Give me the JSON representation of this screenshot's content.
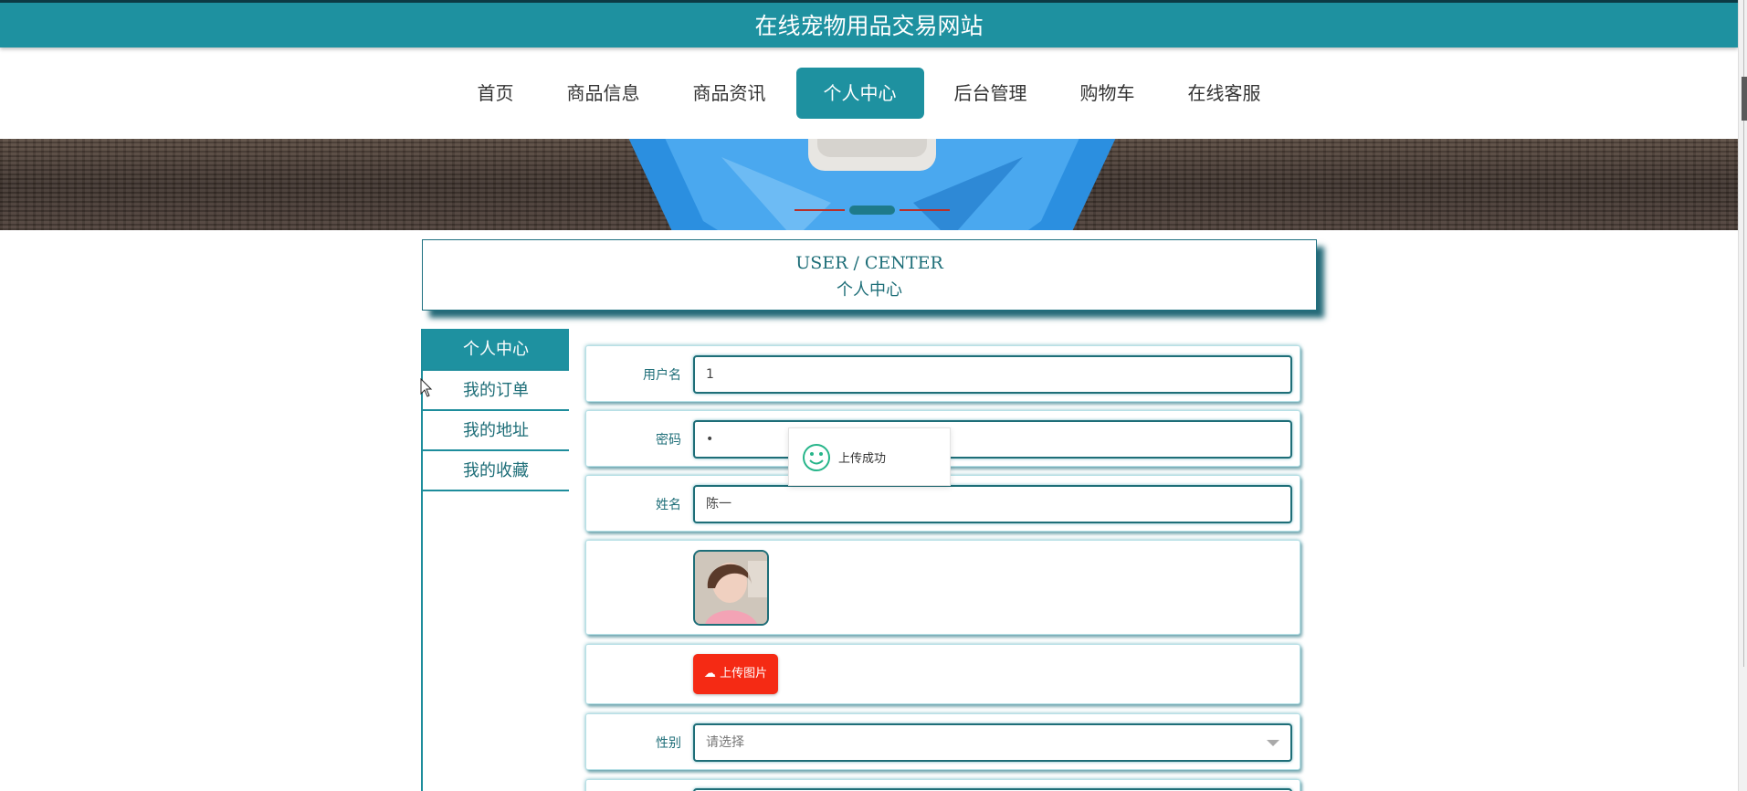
{
  "site": {
    "title": "在线宠物用品交易网站"
  },
  "nav": {
    "items": [
      {
        "label": "首页",
        "active": false
      },
      {
        "label": "商品信息",
        "active": false
      },
      {
        "label": "商品资讯",
        "active": false
      },
      {
        "label": "个人中心",
        "active": true
      },
      {
        "label": "后台管理",
        "active": false
      },
      {
        "label": "购物车",
        "active": false
      },
      {
        "label": "在线客服",
        "active": false
      }
    ]
  },
  "section": {
    "title_en": "USER / CENTER",
    "title_cn": "个人中心"
  },
  "sidebar": {
    "items": [
      {
        "label": "个人中心",
        "active": true
      },
      {
        "label": "我的订单",
        "active": false
      },
      {
        "label": "我的地址",
        "active": false
      },
      {
        "label": "我的收藏",
        "active": false
      }
    ]
  },
  "form": {
    "username": {
      "label": "用户名",
      "value": "1"
    },
    "password": {
      "label": "密码",
      "value": "•"
    },
    "name": {
      "label": "姓名",
      "value": "陈一"
    },
    "avatar": {
      "icon": "avatar-photo"
    },
    "upload": {
      "label": "上传图片",
      "icon": "cloud-upload-icon"
    },
    "gender": {
      "label": "性别",
      "placeholder": "请选择"
    }
  },
  "toast": {
    "message": "上传成功",
    "icon": "smile-icon"
  },
  "colors": {
    "primary": "#1e91a0",
    "upload": "#f52a14",
    "dark": "#0c3a44"
  }
}
